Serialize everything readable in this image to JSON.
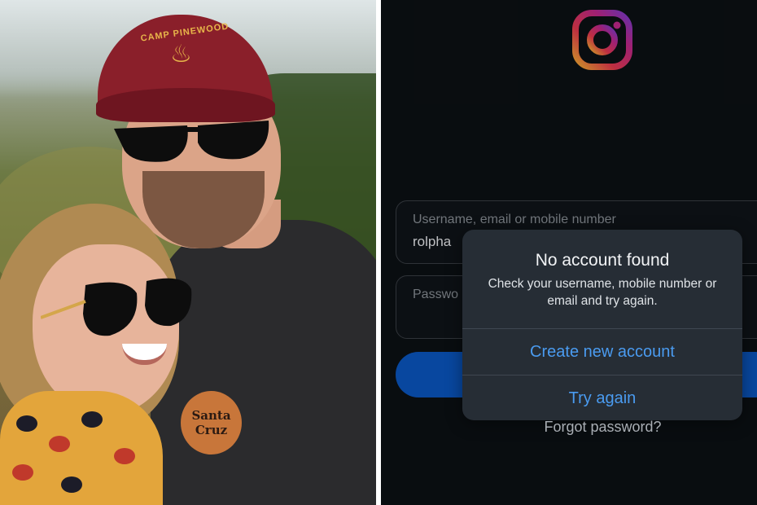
{
  "photo": {
    "cap_text": "CAMP PINEWOOD",
    "shirt_logo_line1": "Santa",
    "shirt_logo_line2": "Cruz"
  },
  "instagram": {
    "logo_icon": "instagram-logo-icon",
    "username_label": "Username, email or mobile number",
    "username_value": "rolpha",
    "password_label": "Passwo",
    "forgot_password": "Forgot password?",
    "colors": {
      "background": "#0c1014",
      "accent": "#4a9bf0",
      "button": "#0a57c2"
    }
  },
  "dialog": {
    "title": "No account found",
    "message": "Check your username, mobile number or email and try again.",
    "create_account": "Create new account",
    "try_again": "Try again"
  }
}
